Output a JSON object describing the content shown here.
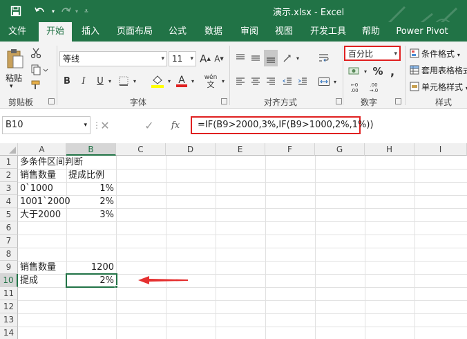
{
  "titlebar": {
    "title": "演示.xlsx  -  Excel",
    "bg": "#217346"
  },
  "tabs": [
    "文件",
    "开始",
    "插入",
    "页面布局",
    "公式",
    "数据",
    "审阅",
    "视图",
    "开发工具",
    "帮助",
    "Power Pivot"
  ],
  "ribbon": {
    "clipboard": {
      "paste": "粘贴",
      "label": "剪贴板"
    },
    "font": {
      "name": "等线",
      "size": "11",
      "label": "字体",
      "bold": "B",
      "italic": "I",
      "underline": "U",
      "fontColor": "A",
      "grow": "A",
      "shrink": "A",
      "phonetic": "wén"
    },
    "alignment": {
      "label": "对齐方式"
    },
    "number": {
      "format": "百分比",
      "label": "数字",
      "percent": "%",
      "comma": ",",
      "inc": "+.0\n.00",
      "dec": ".00\n→.0"
    },
    "styles": {
      "conditional": "条件格式",
      "table": "套用表格格式",
      "cell": "单元格样式",
      "label": "样式"
    }
  },
  "formula_bar": {
    "name_box": "B10",
    "formula": "=IF(B9>2000,3%,IF(B9>1000,2%,1%))"
  },
  "grid": {
    "columns": [
      "A",
      "B",
      "C",
      "D",
      "E",
      "F",
      "G",
      "H",
      "I"
    ],
    "rows": [
      "1",
      "2",
      "3",
      "4",
      "5",
      "6",
      "7",
      "8",
      "9",
      "10",
      "11",
      "12",
      "13",
      "14"
    ],
    "cells": {
      "A1": "多条件区间判断",
      "A2": "销售数量",
      "B2": "提成比例",
      "A3": "0`1000",
      "B3": "1%",
      "A4": "1001`2000",
      "B4": "2%",
      "A5": "大于2000",
      "B5": "3%",
      "A9": "销售数量",
      "B9": "1200",
      "A10": "提成",
      "B10": "2%"
    },
    "selected": "B10"
  },
  "colors": {
    "excel_green": "#217346",
    "highlight_red": "#e02020"
  }
}
